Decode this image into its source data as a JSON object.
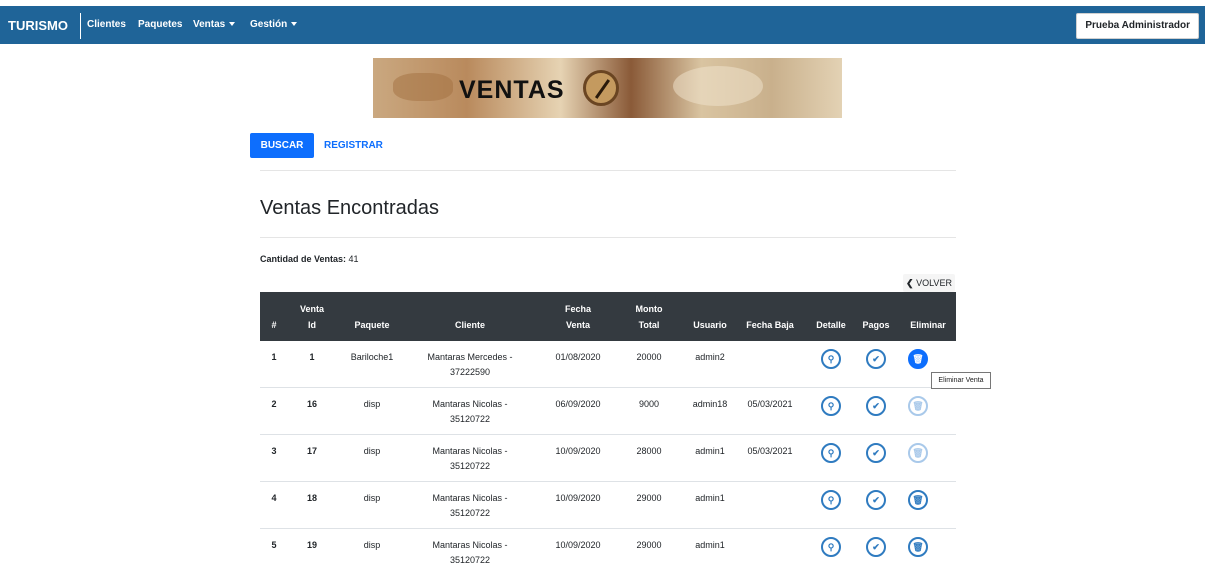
{
  "navbar": {
    "brand": "TURISMO",
    "items": [
      {
        "label": "Clientes"
      },
      {
        "label": "Paquetes"
      },
      {
        "label": "Ventas"
      },
      {
        "label": "Gestión"
      }
    ],
    "user_button": "Prueba Administrador",
    "background": "#1f6498"
  },
  "banner": {
    "title": "VENTAS"
  },
  "actions": {
    "buscar": "BUSCAR",
    "registrar": "REGISTRAR"
  },
  "section_title": "Ventas Encontradas",
  "count": {
    "label": "Cantidad de Ventas:",
    "value": "41"
  },
  "volver_label": "VOLVER",
  "table": {
    "headers": {
      "num": "#",
      "venta_id_1": "Venta",
      "venta_id_2": "Id",
      "paquete": "Paquete",
      "cliente": "Cliente",
      "fecha_venta_1": "Fecha",
      "fecha_venta_2": "Venta",
      "monto_1": "Monto",
      "monto_2": "Total",
      "usuario": "Usuario",
      "fecha_baja": "Fecha Baja",
      "detalle": "Detalle",
      "pagos": "Pagos",
      "eliminar": "Eliminar"
    },
    "rows": [
      {
        "num": "1",
        "venta_id": "1",
        "paquete": "Bariloche1",
        "cliente_1": "Mantaras Mercedes -",
        "cliente_2": "37222590",
        "fecha_venta": "01/08/2020",
        "monto": "20000",
        "usuario": "admin2",
        "fecha_baja": ""
      },
      {
        "num": "2",
        "venta_id": "16",
        "paquete": "disp",
        "cliente_1": "Mantaras Nicolas -",
        "cliente_2": "35120722",
        "fecha_venta": "06/09/2020",
        "monto": "9000",
        "usuario": "admin18",
        "fecha_baja": "05/03/2021"
      },
      {
        "num": "3",
        "venta_id": "17",
        "paquete": "disp",
        "cliente_1": "Mantaras Nicolas -",
        "cliente_2": "35120722",
        "fecha_venta": "10/09/2020",
        "monto": "28000",
        "usuario": "admin1",
        "fecha_baja": "05/03/2021"
      },
      {
        "num": "4",
        "venta_id": "18",
        "paquete": "disp",
        "cliente_1": "Mantaras Nicolas -",
        "cliente_2": "35120722",
        "fecha_venta": "10/09/2020",
        "monto": "29000",
        "usuario": "admin1",
        "fecha_baja": ""
      },
      {
        "num": "5",
        "venta_id": "19",
        "paquete": "disp",
        "cliente_1": "Mantaras Nicolas -",
        "cliente_2": "35120722",
        "fecha_venta": "10/09/2020",
        "monto": "29000",
        "usuario": "admin1",
        "fecha_baja": ""
      }
    ]
  },
  "tooltip": "Eliminar Venta",
  "icons": {
    "detalle": "search-icon",
    "pagos": "check-icon",
    "eliminar": "trash-icon",
    "volver": "chevron-left-icon"
  },
  "colors": {
    "primary": "#0d6efd",
    "table_header": "#343a40"
  }
}
